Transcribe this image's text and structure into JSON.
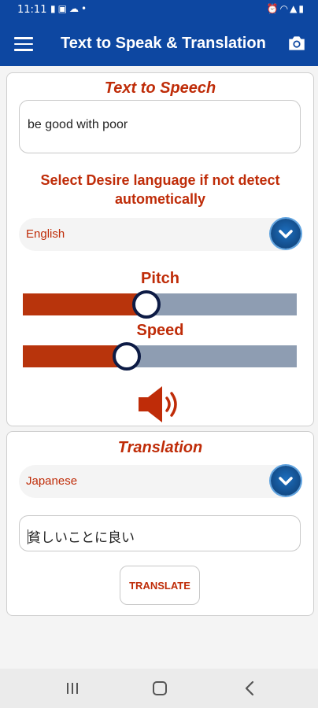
{
  "status_bar": {
    "time": "11:11",
    "left_icons": [
      "notification-icon",
      "gallery-icon",
      "cloud-icon",
      "dot-icon"
    ],
    "right_icons": [
      "alarm-icon",
      "wifi-icon",
      "signal-icon",
      "battery-icon"
    ]
  },
  "app_bar": {
    "title": "Text to Speak & Translation",
    "menu_icon": "hamburger-menu-icon",
    "action_icon": "camera-icon",
    "color": "#0d47a1"
  },
  "tts": {
    "title": "Text to Speech",
    "input_text": "be good with poor",
    "select_language_label": "Select Desire language if not detect autometically",
    "language": "English",
    "pitch": {
      "label": "Pitch",
      "value_fraction": 0.45
    },
    "speed": {
      "label": "Speed",
      "value_fraction": 0.38
    },
    "speak_icon": "speaker-icon"
  },
  "translation": {
    "title": "Translation",
    "language": "Japanese",
    "output_text": "貧しいことに良い",
    "button_label": "TRANSLATE"
  },
  "colors": {
    "accent": "#bf2c08",
    "slider_fill": "#b8340c",
    "slider_rest": "#8e9db2",
    "dropdown_button": "#14508f"
  }
}
